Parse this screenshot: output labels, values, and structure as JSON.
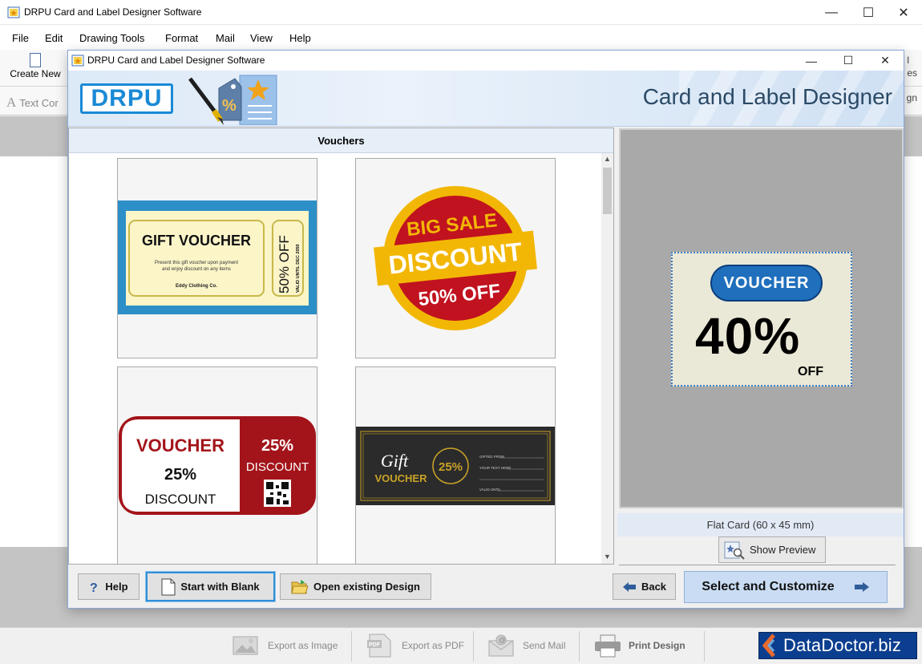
{
  "main_window": {
    "title": "DRPU Card and Label Designer Software",
    "controls": {
      "minimize": "—",
      "maximize": "☐",
      "close": "✕"
    }
  },
  "menu": [
    "File",
    "Edit",
    "Drawing Tools",
    "Format",
    "Mail",
    "View",
    "Help"
  ],
  "toolbar": {
    "create_new_label": "Create New",
    "text_control_label": "Text Cor",
    "right_fragments": [
      "l",
      "es",
      "gn"
    ]
  },
  "dialog": {
    "title": "DRPU Card and Label Designer Software",
    "controls": {
      "minimize": "—",
      "maximize": "☐",
      "close": "✕"
    },
    "banner": {
      "logo": "DRPU",
      "title": "Card and Label Designer"
    },
    "section_title": "Vouchers",
    "templates": [
      {
        "name": "gift-voucher",
        "title": "GIFT VOUCHER",
        "body_line1": "Present this gift voucher upon payment",
        "body_line2": "and enjoy discount on any items",
        "company": "Eddy Clothing Co.",
        "side_big": "50% OFF",
        "side_small": "VALID UNTIL DEC 2050"
      },
      {
        "name": "big-sale-discount",
        "top": "BIG SALE",
        "middle": "DISCOUNT",
        "bottom": "50% OFF"
      },
      {
        "name": "voucher-25",
        "left_title": "VOUCHER",
        "left_pct": "25%",
        "left_word": "DISCOUNT",
        "right_pct": "25%",
        "right_word": "DISCOUNT"
      },
      {
        "name": "gift-voucher-dark",
        "gift": "Gift",
        "voucher": "VOUCHER",
        "pct": "25%",
        "line1": "GIFTED FROM",
        "line2": "YOUR TEXT HERE",
        "line3": "VALID UNTIL"
      }
    ],
    "preview": {
      "pill": "VOUCHER",
      "big": "40%",
      "off": "OFF",
      "card_size": "Flat Card (60 x 45 mm)",
      "show_preview": "Show Preview"
    },
    "buttons": {
      "help": "Help",
      "start_blank": "Start with Blank",
      "open_existing": "Open existing Design",
      "back": "Back",
      "select_customize": "Select and Customize"
    }
  },
  "bottom_bar": {
    "export_image": "Export as Image",
    "export_pdf": "Export as PDF",
    "send_mail": "Send Mail",
    "print_design": "Print Design",
    "brand": "DataDoctor.biz"
  },
  "colors": {
    "accent_blue": "#1a8ad6",
    "voucher_red": "#a3141a",
    "sale_yellow": "#f2b705",
    "dark_voucher": "#2b2b2b",
    "gold": "#c9a227",
    "brand_blue": "#0b3e8e"
  }
}
